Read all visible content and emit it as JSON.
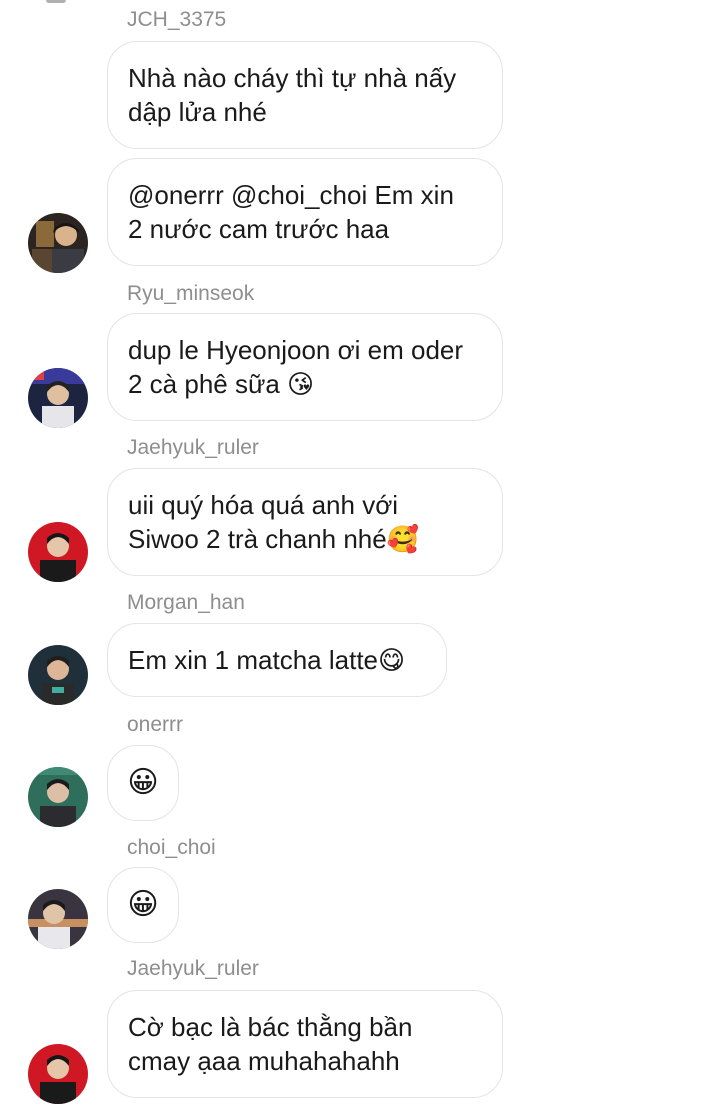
{
  "messages": [
    {
      "sender": "JCH_3375",
      "text": "Nhà nào cháy thì tự nhà nấy\ndập lửa nhé",
      "avatar": null
    },
    {
      "sender": "",
      "text": "@onerrr @choi_choi Em xin\n2 nước cam trước haa",
      "avatar": "avatar-1"
    },
    {
      "sender": "Ryu_minseok",
      "text": "dup le Hyeonjoon ơi em oder\n2 cà phê sữa 😘",
      "avatar": "avatar-2"
    },
    {
      "sender": "Jaehyuk_ruler",
      "text": "uii quý hóa quá anh với\nSiwoo 2 trà chanh nhé🥰",
      "avatar": "avatar-3"
    },
    {
      "sender": "Morgan_han",
      "text": "Em xin 1 matcha latte😋",
      "avatar": "avatar-4"
    },
    {
      "sender": "onerrr",
      "text": "😀",
      "avatar": "avatar-5"
    },
    {
      "sender": "choi_choi",
      "text": "😀",
      "avatar": "avatar-6"
    },
    {
      "sender": "Jaehyuk_ruler",
      "text": "Cờ bạc là bác thằng bần\ncmay ạaa muhahahahh",
      "avatar": "avatar-7"
    }
  ],
  "colors": {
    "sender": "#8e8e8e",
    "bubble_border": "#e4e4e4",
    "text": "#1a1a1a"
  }
}
